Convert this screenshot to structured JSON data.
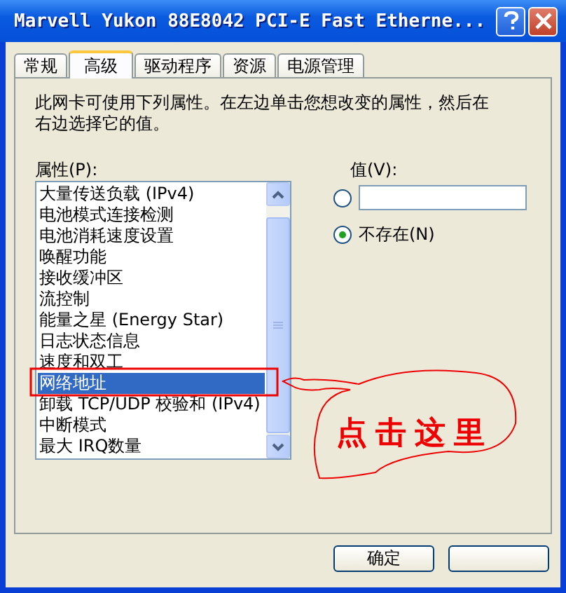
{
  "window": {
    "title": "Marvell Yukon 88E8042 PCI-E Fast Etherne..."
  },
  "tabs": [
    {
      "label": "常规",
      "selected": false
    },
    {
      "label": "高级",
      "selected": true
    },
    {
      "label": "驱动程序",
      "selected": false
    },
    {
      "label": "资源",
      "selected": false
    },
    {
      "label": "电源管理",
      "selected": false
    }
  ],
  "description": "此网卡可使用下列属性。在左边单击您想改变的属性，然后在右边选择它的值。",
  "properties": {
    "label": "属性(P):",
    "items": [
      {
        "label": "大量传送负载 (IPv4)",
        "selected": false
      },
      {
        "label": "电池模式连接检测",
        "selected": false
      },
      {
        "label": "电池消耗速度设置",
        "selected": false
      },
      {
        "label": "唤醒功能",
        "selected": false
      },
      {
        "label": "接收缓冲区",
        "selected": false
      },
      {
        "label": "流控制",
        "selected": false
      },
      {
        "label": "能量之星 (Energy Star)",
        "selected": false
      },
      {
        "label": "日志状态信息",
        "selected": false
      },
      {
        "label": "速度和双工",
        "selected": false
      },
      {
        "label": "网络地址",
        "selected": true
      },
      {
        "label": "卸载 TCP/UDP 校验和 (IPv4)",
        "selected": false
      },
      {
        "label": "中断模式",
        "selected": false
      },
      {
        "label": "最大 IRQ数量",
        "selected": false
      }
    ]
  },
  "value": {
    "label": "值(V):",
    "options": [
      {
        "kind": "input",
        "selected": false
      },
      {
        "kind": "text",
        "label": "不存在(N)",
        "selected": true
      }
    ]
  },
  "annotation": {
    "text": "点击这里"
  },
  "buttons": [
    {
      "label": "确定"
    }
  ]
}
